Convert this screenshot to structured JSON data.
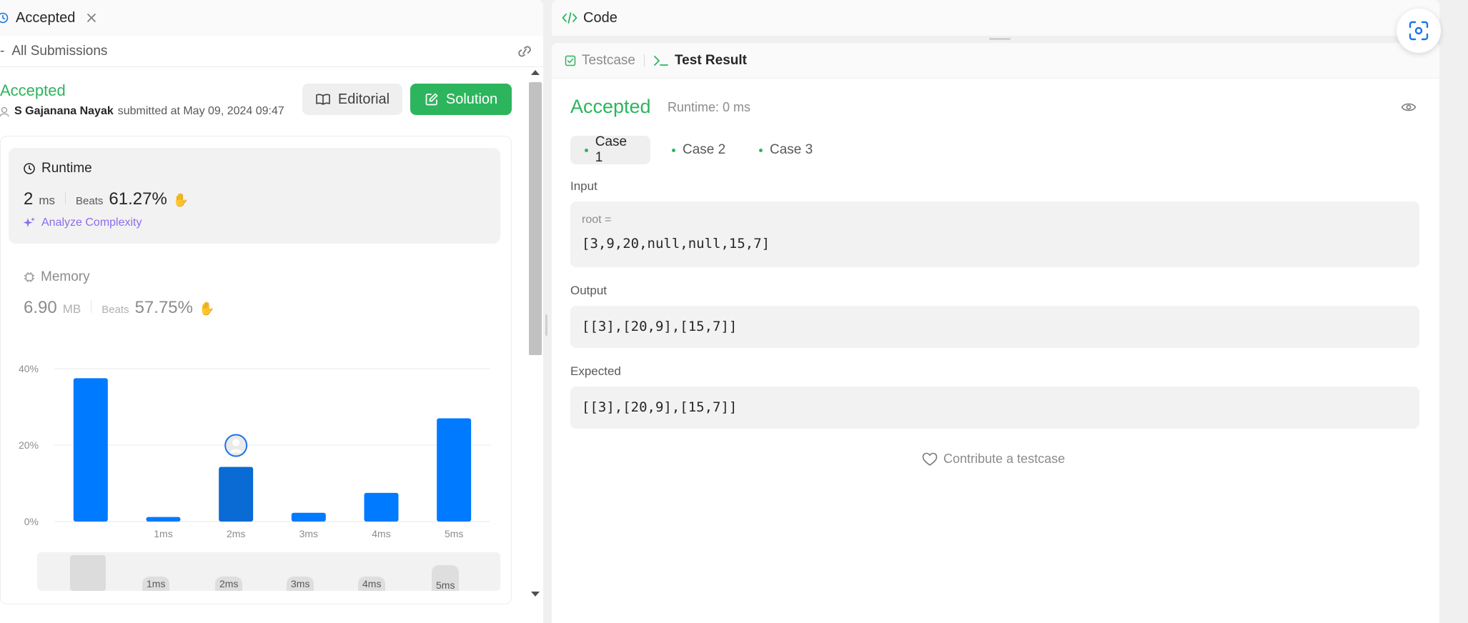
{
  "left": {
    "tab_title": "Accepted",
    "subheader": "All Submissions",
    "status": "Accepted",
    "author": "S Gajanana Nayak",
    "submitted_text": "submitted at May 09, 2024 09:47",
    "editorial_label": "Editorial",
    "solution_label": "Solution",
    "runtime": {
      "label": "Runtime",
      "value": "2",
      "unit": "ms",
      "beats_label": "Beats",
      "beats_value": "61.27%",
      "analyze_label": "Analyze Complexity"
    },
    "memory": {
      "label": "Memory",
      "value": "6.90",
      "unit": "MB",
      "beats_label": "Beats",
      "beats_value": "57.75%"
    },
    "navigator_labels": [
      "1ms",
      "2ms",
      "3ms",
      "4ms",
      "5ms"
    ]
  },
  "chart_data": {
    "type": "bar",
    "categories": [
      "",
      "1ms",
      "2ms",
      "3ms",
      "4ms",
      "5ms"
    ],
    "values": [
      37.5,
      1.2,
      14.3,
      2.3,
      7.5,
      27.0
    ],
    "highlight_index": 2,
    "yticks": [
      "0%",
      "20%",
      "40%"
    ],
    "ylim": [
      0,
      40
    ],
    "title": "",
    "xlabel": "",
    "ylabel": "",
    "bar_color": "#007aff",
    "highlight_color": "#0a6bd4"
  },
  "right": {
    "code_tab": "Code",
    "testcase_tab": "Testcase",
    "test_result_tab": "Test Result",
    "status": "Accepted",
    "runtime_text": "Runtime: 0 ms",
    "cases": [
      "Case 1",
      "Case 2",
      "Case 3"
    ],
    "input_label": "Input",
    "input_var": "root =",
    "input_value": "[3,9,20,null,null,15,7]",
    "output_label": "Output",
    "output_value": "[[3],[20,9],[15,7]]",
    "expected_label": "Expected",
    "expected_value": "[[3],[20,9],[15,7]]",
    "contribute_label": "Contribute a testcase"
  },
  "colors": {
    "accent_green": "#2db55d",
    "blue": "#007aff",
    "purple": "#8c6cf0"
  }
}
